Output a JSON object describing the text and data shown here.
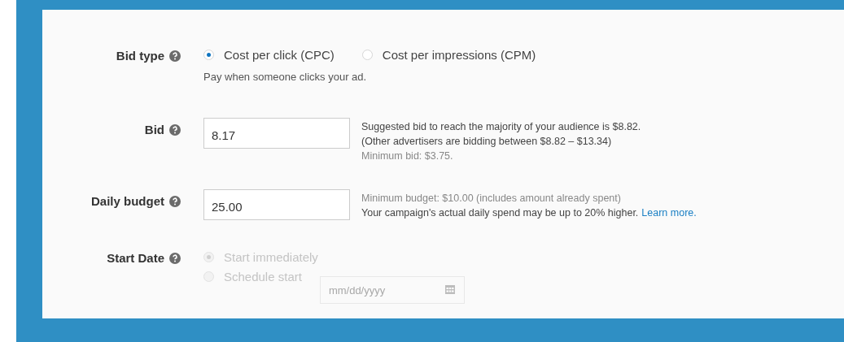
{
  "fields": [
    {
      "kind": "radios",
      "label": "Bid type",
      "disabled": false,
      "options": [
        {
          "label": "Cost per click (CPC)",
          "selected": true
        },
        {
          "label": "Cost per impressions (CPM)",
          "selected": false
        }
      ],
      "help": "Pay when someone clicks your ad."
    },
    {
      "kind": "input",
      "label": "Bid",
      "value": "8.17",
      "hints": [
        {
          "text": "Suggested bid to reach the majority of your audience is $8.82.",
          "muted": false
        },
        {
          "text": "(Other advertisers are bidding between $8.82 – $13.34)",
          "muted": false
        },
        {
          "text": "Minimum bid: $3.75.",
          "muted": true
        }
      ]
    },
    {
      "kind": "input",
      "label": "Daily budget",
      "value": "25.00",
      "hints": [
        {
          "text": "Minimum budget: $10.00 (includes amount already spent)",
          "muted": true
        },
        {
          "text": "Your campaign's actual daily spend may be up to 20% higher.",
          "muted": false,
          "link": "Learn more."
        }
      ]
    },
    {
      "kind": "stack",
      "label": "Start Date",
      "disabled": true,
      "options": [
        {
          "label": "Start immediately",
          "selected": true
        },
        {
          "label": "Schedule start",
          "selected": false,
          "date_placeholder": "mm/dd/yyyy"
        }
      ]
    }
  ]
}
